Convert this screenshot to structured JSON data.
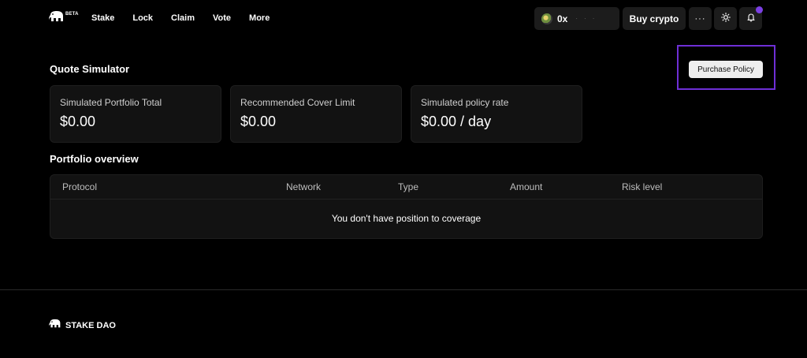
{
  "header": {
    "beta_badge": "BETA",
    "nav": [
      "Stake",
      "Lock",
      "Claim",
      "Vote",
      "More"
    ],
    "wallet": {
      "address_prefix": "0x"
    },
    "buy_label": "Buy crypto",
    "more_label": "···",
    "accent_color": "#7b3fe4"
  },
  "quote_simulator": {
    "title": "Quote Simulator",
    "purchase_label": "Purchase Policy",
    "cards": [
      {
        "label": "Simulated Portfolio Total",
        "value": "$0.00"
      },
      {
        "label": "Recommended Cover Limit",
        "value": "$0.00"
      },
      {
        "label": "Simulated policy rate",
        "value": "$0.00 / day"
      }
    ]
  },
  "portfolio": {
    "title": "Portfolio overview",
    "columns": [
      "Protocol",
      "Network",
      "Type",
      "Amount",
      "Risk level"
    ],
    "empty_message": "You don't have position to coverage"
  },
  "footer": {
    "brand": "STAKE DAO"
  }
}
